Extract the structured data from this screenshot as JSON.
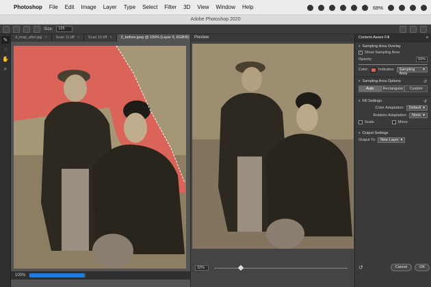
{
  "menubar": {
    "app": "Photoshop",
    "items": [
      "File",
      "Edit",
      "Image",
      "Layer",
      "Type",
      "Select",
      "Filter",
      "3D",
      "View",
      "Window",
      "Help"
    ],
    "battery": "68%"
  },
  "window": {
    "title": "Adobe Photoshop 2020"
  },
  "options": {
    "size_label": "Size:",
    "size_value": "125"
  },
  "tabs": [
    {
      "label": "d_map_after.jpg"
    },
    {
      "label": "Scan 11.tiff"
    },
    {
      "label": "Scan 10.tiff"
    },
    {
      "label": "3_before.jpeg @ 100% (Layer 0, RGB/8) *"
    }
  ],
  "status": {
    "zoom": "100%"
  },
  "preview": {
    "label": "Preview",
    "zoom": "32%"
  },
  "panel": {
    "title": "Content-Aware Fill",
    "sampling_overlay": {
      "header": "Sampling Area Overlay",
      "show_label": "Show Sampling Area",
      "opacity_label": "Opacity:",
      "opacity_value": "50%",
      "color_label": "Color:",
      "indicates_label": "Indicates:",
      "indicates_value": "Sampling Area"
    },
    "sampling_options": {
      "header": "Sampling Area Options",
      "modes": [
        "Auto",
        "Rectangular",
        "Custom"
      ]
    },
    "fill_settings": {
      "header": "Fill Settings",
      "color_adaptation_label": "Color Adaptation:",
      "color_adaptation_value": "Default",
      "rotation_adaptation_label": "Rotation Adaptation:",
      "rotation_adaptation_value": "None",
      "scale_label": "Scale",
      "mirror_label": "Mirror"
    },
    "output": {
      "header": "Output Settings",
      "output_to_label": "Output To:",
      "output_to_value": "New Layer"
    },
    "buttons": {
      "cancel": "Cancel",
      "ok": "OK"
    }
  },
  "colors": {
    "sampling_overlay": "#e06058",
    "progress": "#1f7de0"
  }
}
